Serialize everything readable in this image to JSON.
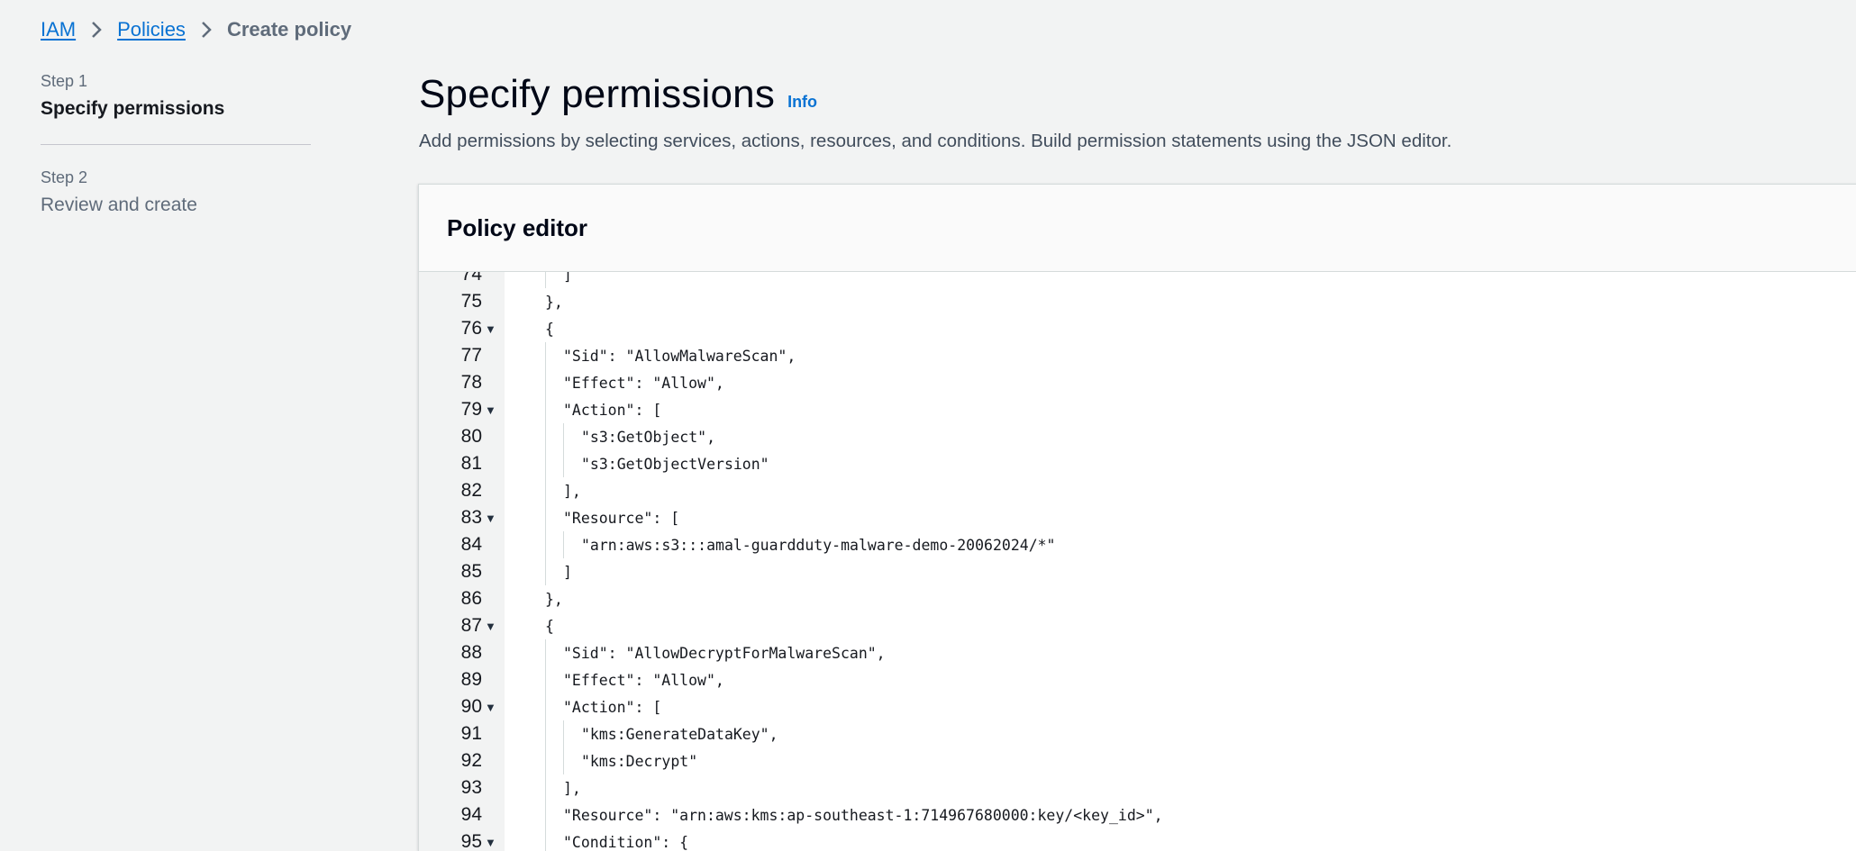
{
  "breadcrumb": {
    "items": [
      "IAM",
      "Policies"
    ],
    "current": "Create policy"
  },
  "steps": [
    {
      "num": "Step 1",
      "title": "Specify permissions"
    },
    {
      "num": "Step 2",
      "title": "Review and create"
    }
  ],
  "header": {
    "title": "Specify permissions",
    "info": "Info",
    "description": "Add permissions by selecting services, actions, resources, and conditions. Build permission statements using the JSON editor."
  },
  "editor": {
    "title": "Policy editor",
    "lines": [
      {
        "n": "74",
        "fold": false,
        "indent": 2,
        "text": "]"
      },
      {
        "n": "75",
        "fold": false,
        "indent": 1,
        "text": "},"
      },
      {
        "n": "76",
        "fold": true,
        "indent": 1,
        "text": "{"
      },
      {
        "n": "77",
        "fold": false,
        "indent": 2,
        "text": "\"Sid\": \"AllowMalwareScan\","
      },
      {
        "n": "78",
        "fold": false,
        "indent": 2,
        "text": "\"Effect\": \"Allow\","
      },
      {
        "n": "79",
        "fold": true,
        "indent": 2,
        "text": "\"Action\": ["
      },
      {
        "n": "80",
        "fold": false,
        "indent": 3,
        "text": "\"s3:GetObject\","
      },
      {
        "n": "81",
        "fold": false,
        "indent": 3,
        "text": "\"s3:GetObjectVersion\""
      },
      {
        "n": "82",
        "fold": false,
        "indent": 2,
        "text": "],"
      },
      {
        "n": "83",
        "fold": true,
        "indent": 2,
        "text": "\"Resource\": ["
      },
      {
        "n": "84",
        "fold": false,
        "indent": 3,
        "text": "\"arn:aws:s3:::amal-guardduty-malware-demo-20062024/*\""
      },
      {
        "n": "85",
        "fold": false,
        "indent": 2,
        "text": "]"
      },
      {
        "n": "86",
        "fold": false,
        "indent": 1,
        "text": "},"
      },
      {
        "n": "87",
        "fold": true,
        "indent": 1,
        "text": "{"
      },
      {
        "n": "88",
        "fold": false,
        "indent": 2,
        "text": "\"Sid\": \"AllowDecryptForMalwareScan\","
      },
      {
        "n": "89",
        "fold": false,
        "indent": 2,
        "text": "\"Effect\": \"Allow\","
      },
      {
        "n": "90",
        "fold": true,
        "indent": 2,
        "text": "\"Action\": ["
      },
      {
        "n": "91",
        "fold": false,
        "indent": 3,
        "text": "\"kms:GenerateDataKey\","
      },
      {
        "n": "92",
        "fold": false,
        "indent": 3,
        "text": "\"kms:Decrypt\""
      },
      {
        "n": "93",
        "fold": false,
        "indent": 2,
        "text": "],"
      },
      {
        "n": "94",
        "fold": false,
        "indent": 2,
        "text": "\"Resource\": \"arn:aws:kms:ap-southeast-1:714967680000:key/<key_id>\","
      },
      {
        "n": "95",
        "fold": true,
        "indent": 2,
        "text": "\"Condition\": {"
      }
    ]
  },
  "colors": {
    "link": "#0972d3",
    "background": "#f2f3f3",
    "gutter": "#f2f3f3"
  }
}
